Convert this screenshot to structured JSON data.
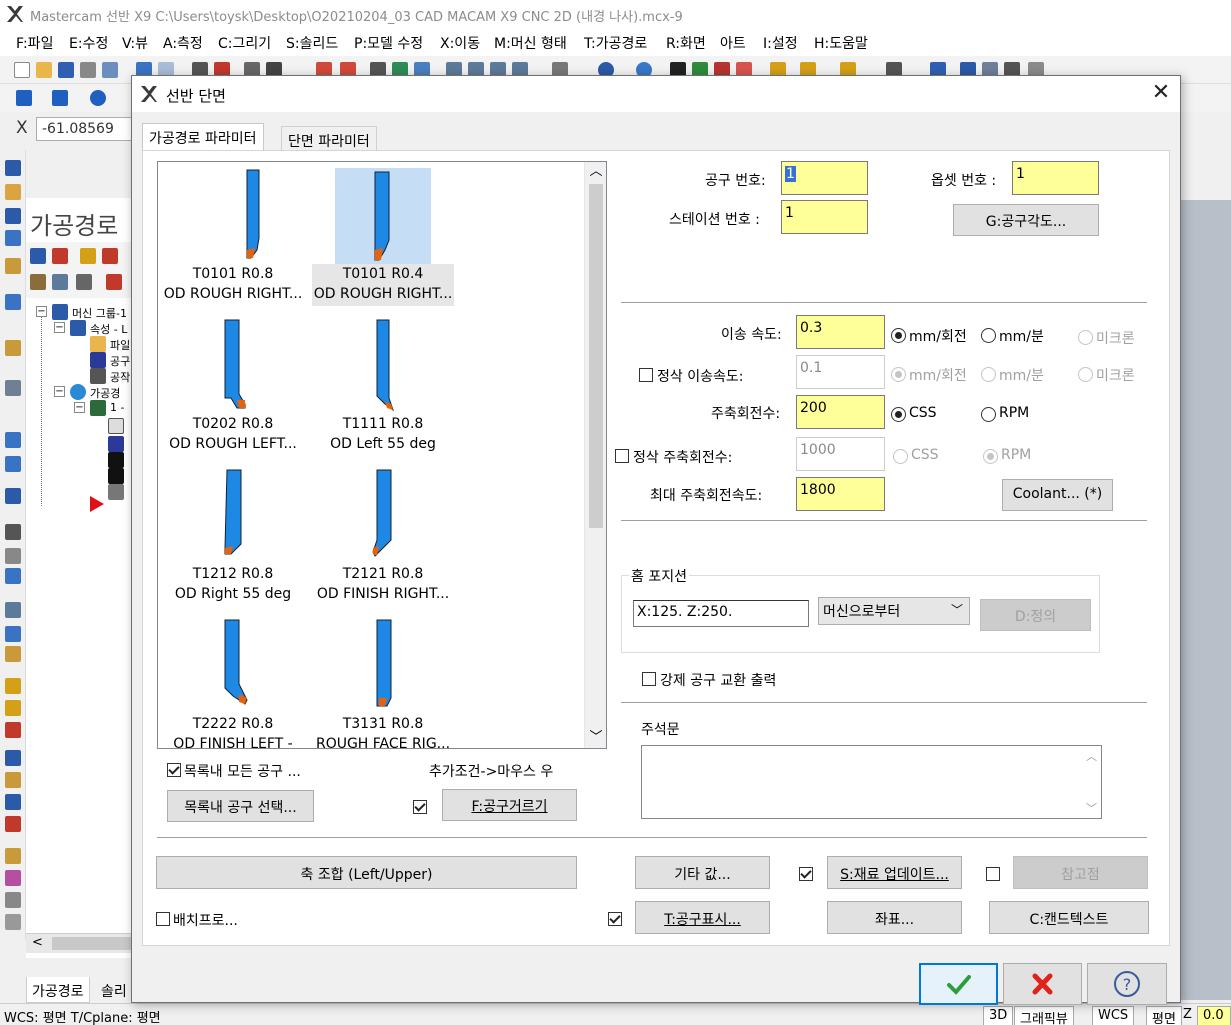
{
  "app": {
    "title": "Mastercam 선반 X9  C:\\Users\\toysk\\Desktop\\O20210204_03 CAD MACAM X9 CNC 2D (내경 나사).mcx-9",
    "menu": [
      "F:파일",
      "E:수정",
      "V:뷰",
      "A:측정",
      "C:그리기",
      "S:솔리드",
      "P:모델 수정",
      "X:이동",
      "M:머신 형태",
      "T:가공경로",
      "R:화면",
      "아트",
      "I:설정",
      "H:도움말"
    ],
    "coord_label": "X",
    "coord_value": "-61.08569",
    "panel_title": "가공경로",
    "tree": [
      "머신 그룹-1",
      "속성 - L",
      "파일",
      "공구",
      "공작",
      "가공경",
      "1 -"
    ],
    "bottom_tabs": [
      "가공경로",
      "솔리"
    ],
    "status": {
      "wcs_text": "WCS: 평면  T/Cplane: 평면",
      "btn_3d": "3D",
      "btn_graphic": "그래픽뷰",
      "btn_wcs": "WCS",
      "btn_plane": "평면",
      "z_label": "Z",
      "z_value": "0.0"
    }
  },
  "dialog": {
    "title": "선반 단면",
    "tabs": [
      "가공경로 파라미터",
      "단면 파라미터"
    ],
    "tools": [
      {
        "line1": "T0101 R0.8",
        "line2": "OD ROUGH RIGHT..."
      },
      {
        "line1": "T0101 R0.4",
        "line2": "OD ROUGH RIGHT..."
      },
      {
        "line1": "T0202 R0.8",
        "line2": "OD ROUGH LEFT..."
      },
      {
        "line1": "T1111 R0.8",
        "line2": "OD Left 55 deg"
      },
      {
        "line1": "T1212 R0.8",
        "line2": "OD Right 55 deg"
      },
      {
        "line1": "T2121 R0.8",
        "line2": "OD FINISH RIGHT..."
      },
      {
        "line1": "T2222 R0.8",
        "line2": "OD FINISH LEFT -"
      },
      {
        "line1": "T3131 R0.8",
        "line2": "ROUGH FACE RIG..."
      }
    ],
    "show_all_tools_label": "목록내 모든 공구 ...",
    "extra_conditions_label": "추가조건->마우스 우",
    "select_tool_btn": "목록내 공구 선택...",
    "tool_filter_btn": "F:공구거르기",
    "tool_number_label": "공구 번호:",
    "tool_number_value": "1",
    "offset_number_label": "옵셋 번호 :",
    "offset_number_value": "1",
    "station_number_label": "스테이션 번호 :",
    "station_number_value": "1",
    "tool_angle_btn": "G:공구각도...",
    "feed_rate_label": "이송 속도:",
    "feed_rate_value": "0.3",
    "finish_feed_label": "정삭 이송속도:",
    "finish_feed_value": "0.1",
    "unit_mm_rev": "mm/회전",
    "unit_mm_min": "mm/분",
    "unit_micron": "미크론",
    "spindle_label": "주축회전수:",
    "spindle_value": "200",
    "css_label": "CSS",
    "rpm_label": "RPM",
    "finish_spindle_label": "정삭 주축회전수:",
    "finish_spindle_value": "1000",
    "max_spindle_label": "최대 주축회전속도:",
    "max_spindle_value": "1800",
    "coolant_btn": "Coolant... (*)",
    "home_position_title": "홈 포지션",
    "home_position_value": "X:125.  Z:250.",
    "home_source_value": "머신으로부터",
    "define_btn": "D:정의",
    "force_tool_change_label": "강제 공구 교환 출력",
    "comment_label": "주석문",
    "axis_combo_btn": "축 조합 (Left/Upper)",
    "misc_values_btn": "기타 값...",
    "stock_update_btn": "S:재료 업데이트...",
    "reference_point_btn": "참고점",
    "batch_label": "배치프로...",
    "tool_display_btn": "T:공구표시...",
    "coordinates_btn": "좌표...",
    "canned_text_btn": "C:캔드텍스트"
  },
  "colors": {
    "tool_blue": "#1e88e5",
    "insert_orange": "#e8620c",
    "highlight_field": "#ffff99",
    "selection": "#c5ddf5"
  }
}
